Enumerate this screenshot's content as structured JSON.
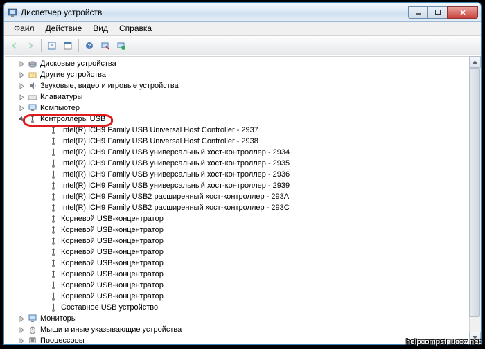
{
  "window": {
    "title": "Диспетчер устройств"
  },
  "menu": {
    "file": "Файл",
    "action": "Действие",
    "view": "Вид",
    "help": "Справка"
  },
  "tree": {
    "root_items": [
      {
        "label": "Дисковые устройства",
        "icon": "disk"
      },
      {
        "label": "Другие устройства",
        "icon": "other"
      },
      {
        "label": "Звуковые, видео и игровые устройства",
        "icon": "sound"
      },
      {
        "label": "Клавиатуры",
        "icon": "keyboard"
      },
      {
        "label": "Компьютер",
        "icon": "computer"
      }
    ],
    "usb_category": {
      "label": "Контроллеры USB",
      "icon": "usb"
    },
    "usb_children": [
      {
        "label": "Intel(R) ICH9 Family USB Universal Host Controller - 2937"
      },
      {
        "label": "Intel(R) ICH9 Family USB Universal Host Controller - 2938"
      },
      {
        "label": "Intel(R) ICH9 Family USB универсальный хост-контроллер  - 2934"
      },
      {
        "label": "Intel(R) ICH9 Family USB универсальный хост-контроллер  - 2935"
      },
      {
        "label": "Intel(R) ICH9 Family USB универсальный хост-контроллер  - 2936"
      },
      {
        "label": "Intel(R) ICH9 Family USB универсальный хост-контроллер  - 2939"
      },
      {
        "label": "Intel(R) ICH9 Family USB2 расширенный хост-контроллер  - 293A"
      },
      {
        "label": "Intel(R) ICH9 Family USB2 расширенный хост-контроллер  - 293C"
      },
      {
        "label": "Корневой USB-концентратор"
      },
      {
        "label": "Корневой USB-концентратор"
      },
      {
        "label": "Корневой USB-концентратор"
      },
      {
        "label": "Корневой USB-концентратор"
      },
      {
        "label": "Корневой USB-концентратор"
      },
      {
        "label": "Корневой USB-концентратор"
      },
      {
        "label": "Корневой USB-концентратор"
      },
      {
        "label": "Корневой USB-концентратор"
      },
      {
        "label": "Составное USB устройство"
      }
    ],
    "bottom_items": [
      {
        "label": "Мониторы",
        "icon": "monitor"
      },
      {
        "label": "Мыши и иные указывающие устройства",
        "icon": "mouse"
      },
      {
        "label": "Процессоры",
        "icon": "cpu"
      }
    ]
  },
  "watermark": "helpcompstr.ucoz.net"
}
